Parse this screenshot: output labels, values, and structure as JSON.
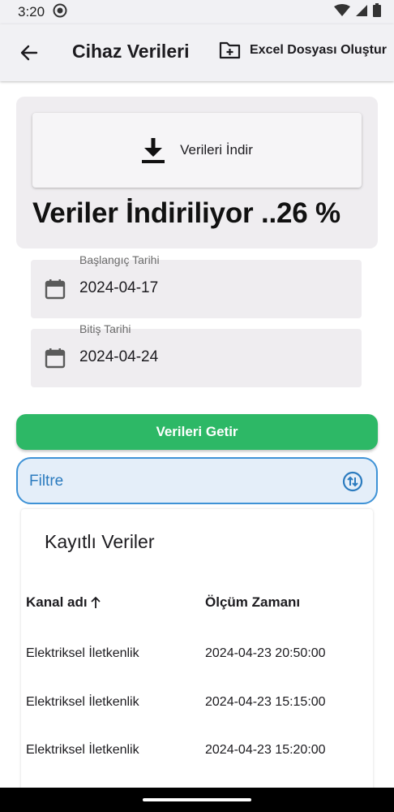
{
  "status_bar": {
    "time": "3:20"
  },
  "app_bar": {
    "title": "Cihaz Verileri",
    "excel_button_label": "Excel Dosyası Oluştur"
  },
  "download": {
    "button_label": "Verileri İndir",
    "progress_text": "Veriler İndiriliyor ..26 %",
    "progress_percent": 26
  },
  "start_date": {
    "label": "Başlangıç Tarihi",
    "value": "2024-04-17"
  },
  "end_date": {
    "label": "Bitiş Tarihi",
    "value": "2024-04-24"
  },
  "fetch_button_label": "Verileri Getir",
  "filter": {
    "placeholder": "Filtre"
  },
  "records": {
    "title": "Kayıtlı Veriler",
    "columns": [
      "Kanal adı",
      "Ölçüm Zamanı"
    ],
    "rows": [
      [
        "Elektriksel İletkenlik",
        "2024-04-23 20:50:00"
      ],
      [
        "Elektriksel İletkenlik",
        "2024-04-23 15:15:00"
      ],
      [
        "Elektriksel İletkenlik",
        "2024-04-23 15:20:00"
      ]
    ]
  },
  "colors": {
    "accent_green": "#2db866",
    "filter_blue": "#3e92d6",
    "surface": "#efedf0"
  }
}
